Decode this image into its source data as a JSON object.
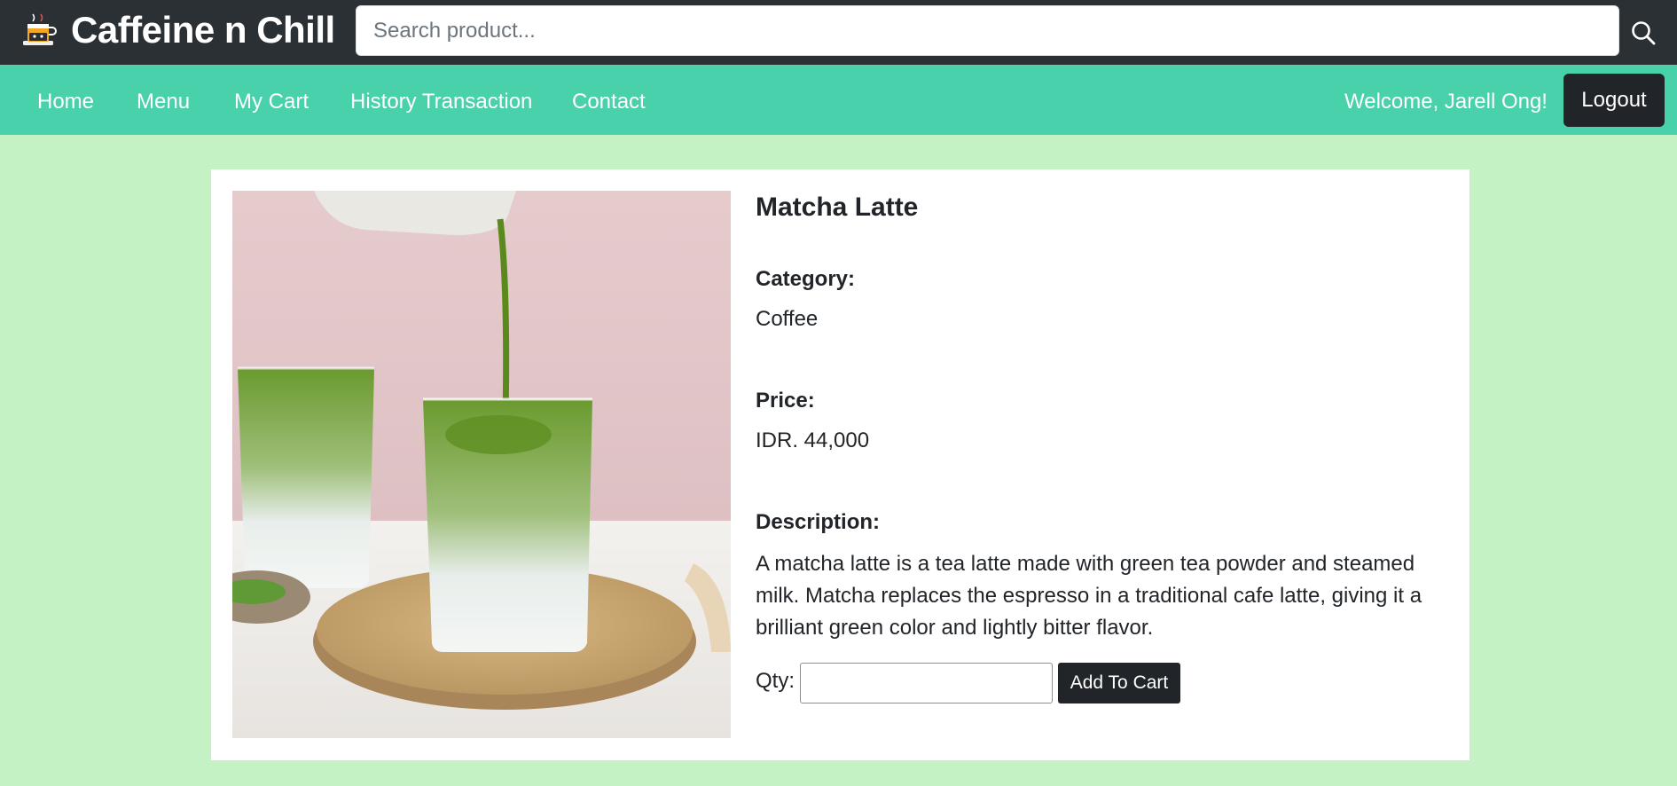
{
  "brand": {
    "name": "Caffeine n Chill",
    "logo_icon": "coffee-cup-logo-icon"
  },
  "search": {
    "placeholder": "Search product...",
    "value": "",
    "icon": "search-icon"
  },
  "nav": {
    "links": [
      "Home",
      "Menu",
      "My Cart",
      "History Transaction",
      "Contact"
    ],
    "welcome": "Welcome, Jarell Ong!",
    "logout_label": "Logout"
  },
  "product": {
    "name": "Matcha Latte",
    "category_label": "Category:",
    "category": "Coffee",
    "price_label": "Price:",
    "price": "IDR. 44,000",
    "description_label": "Description:",
    "description": "A matcha latte is a tea latte made with green tea powder and steamed milk. Matcha replaces the espresso in a traditional cafe latte, giving it a brilliant green color and lightly bitter flavor.",
    "image_alt": "Matcha Latte"
  },
  "cart_form": {
    "qty_label": "Qty:",
    "qty_value": "",
    "add_label": "Add To Cart"
  },
  "colors": {
    "page_bg": "#c5f2c5",
    "topbar_bg": "#2b3035",
    "navbar_bg": "#48d1aa",
    "button_dark": "#212529",
    "card_bg": "#ffffff"
  }
}
